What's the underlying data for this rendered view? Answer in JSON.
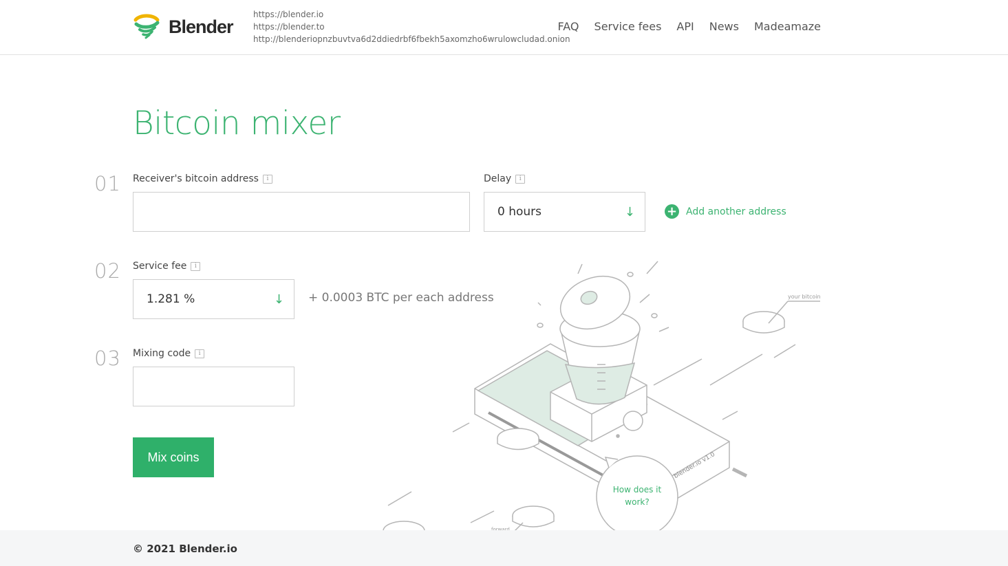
{
  "brand": {
    "name": "Blender",
    "accent": "#3cb371",
    "logo_yellow": "#f0b400"
  },
  "header": {
    "mirrors": [
      "https://blender.io",
      "https://blender.to",
      "http://blenderiopnzbuvtva6d2ddiedrbf6fbekh5axomzho6wrulowcludad.onion"
    ],
    "nav": [
      "FAQ",
      "Service fees",
      "API",
      "News",
      "Madeamaze"
    ]
  },
  "main": {
    "title": "Bitcoin mixer",
    "step1": {
      "num": "01",
      "label": "Receiver's bitcoin address",
      "value": ""
    },
    "delay": {
      "label": "Delay",
      "value": "0 hours"
    },
    "add_address": "Add another address",
    "step2": {
      "num": "02",
      "label": "Service fee",
      "value": "1.281 %",
      "extra": "+ 0.0003 BTC per each address"
    },
    "step3": {
      "num": "03",
      "label": "Mixing code",
      "value": ""
    },
    "submit": "Mix coins",
    "info_icon": "i",
    "arrow_icon": "↓",
    "plus_icon": "+"
  },
  "illustration": {
    "how_it_works": "How does it work?",
    "your_bitcoin": "your bitcoin",
    "forward_address": "forward address",
    "device_label": "blender.io v1.0"
  },
  "footer": {
    "copyright": "© 2021 Blender.io"
  }
}
